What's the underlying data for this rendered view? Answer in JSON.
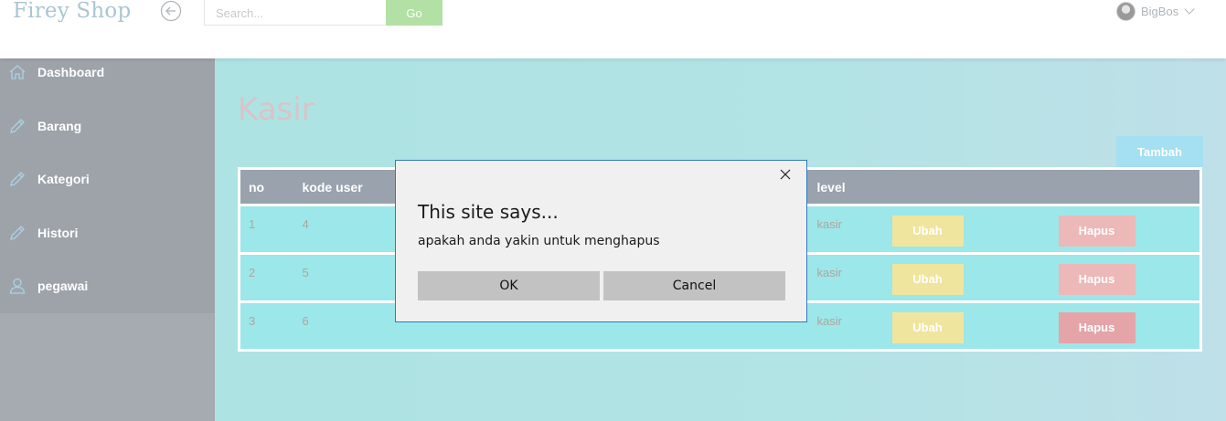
{
  "header": {
    "brand": "Firey Shop",
    "search_placeholder": "Search...",
    "go_label": "Go",
    "username": "BigBos"
  },
  "sidebar": {
    "items": [
      {
        "label": "Dashboard",
        "icon": "home-icon"
      },
      {
        "label": "Barang",
        "icon": "pencil-icon"
      },
      {
        "label": "Kategori",
        "icon": "pencil-icon"
      },
      {
        "label": "Histori",
        "icon": "pencil-icon"
      },
      {
        "label": "pegawai",
        "icon": "user-icon"
      }
    ]
  },
  "main": {
    "title": "Kasir",
    "add_label": "Tambah",
    "table": {
      "headers": [
        "no",
        "kode user",
        "level"
      ],
      "rows": [
        {
          "no": "1",
          "kode_user": "4",
          "level": "kasir",
          "ubah": "Ubah",
          "hapus": "Hapus"
        },
        {
          "no": "2",
          "kode_user": "5",
          "level": "kasir",
          "ubah": "Ubah",
          "hapus": "Hapus"
        },
        {
          "no": "3",
          "kode_user": "6",
          "level": "kasir",
          "ubah": "Ubah",
          "hapus": "Hapus"
        }
      ]
    }
  },
  "dialog": {
    "title": "This site says...",
    "message": "apakah anda yakin untuk menghapus",
    "ok_label": "OK",
    "cancel_label": "Cancel"
  },
  "colors": {
    "sidebar": "#9ea3aa",
    "main_bg": "#ade3e3",
    "table_header": "#99a2ad",
    "table_row": "#9ce7ea",
    "ubah": "#f0e59e",
    "hapus": "#edb8b8",
    "go": "#b3e0a4",
    "tambah": "#a4dff2"
  }
}
